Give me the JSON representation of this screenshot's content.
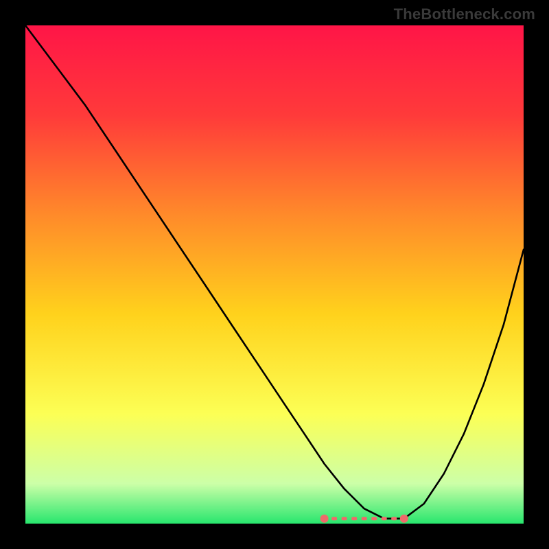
{
  "watermark": "TheBottleneck.com",
  "chart_data": {
    "type": "line",
    "title": "",
    "xlabel": "",
    "ylabel": "",
    "xlim": [
      0,
      100
    ],
    "ylim": [
      0,
      100
    ],
    "gradient_stops": [
      {
        "pct": 0,
        "color": "#ff1547"
      },
      {
        "pct": 18,
        "color": "#ff3a3a"
      },
      {
        "pct": 38,
        "color": "#ff8a2a"
      },
      {
        "pct": 58,
        "color": "#ffd21c"
      },
      {
        "pct": 78,
        "color": "#fcff55"
      },
      {
        "pct": 92,
        "color": "#ccffa8"
      },
      {
        "pct": 100,
        "color": "#28e66e"
      }
    ],
    "series": [
      {
        "name": "bottleneck-curve",
        "color": "#000000",
        "x": [
          0,
          6,
          12,
          18,
          24,
          30,
          36,
          42,
          48,
          52,
          56,
          60,
          64,
          68,
          72,
          76,
          80,
          84,
          88,
          92,
          96,
          100
        ],
        "values": [
          100,
          92,
          84,
          75,
          66,
          57,
          48,
          39,
          30,
          24,
          18,
          12,
          7,
          3,
          1,
          1,
          4,
          10,
          18,
          28,
          40,
          55
        ]
      },
      {
        "name": "optimal-range-markers",
        "color": "#ef6a6a",
        "type": "scatter",
        "x": [
          60,
          62,
          64,
          66,
          68,
          70,
          72,
          74,
          76
        ],
        "values": [
          1,
          1,
          1,
          1,
          1,
          1,
          1,
          1,
          1
        ]
      }
    ],
    "optimal_range": {
      "x_start": 60,
      "x_end": 76
    }
  }
}
